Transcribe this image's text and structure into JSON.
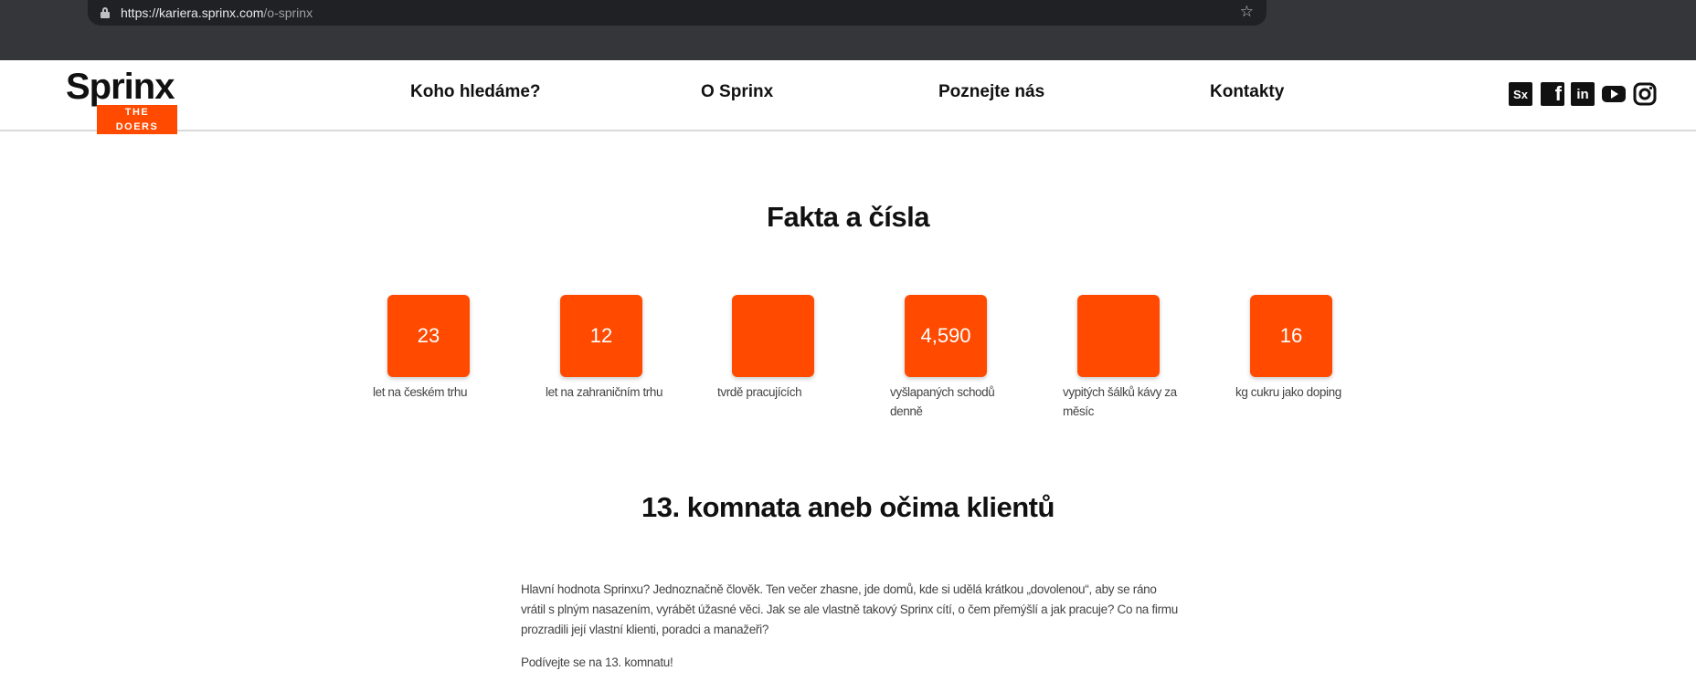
{
  "browser": {
    "url_host": "https://kariera.sprinx.com",
    "url_path": "/o-sprinx"
  },
  "header": {
    "logo_word": "Sprinx",
    "logo_tagline": "THE DOERS",
    "nav": [
      "Koho hledáme?",
      "O Sprinx",
      "Poznejte nás",
      "Kontakty"
    ],
    "social_icons": [
      "sx-icon",
      "facebook-icon",
      "linkedin-icon",
      "youtube-icon",
      "instagram-icon"
    ],
    "social_sx_label": "Sx",
    "social_fb_label": "f",
    "social_in_label": "in"
  },
  "facts": {
    "title": "Fakta a čísla",
    "items": [
      {
        "value": "23",
        "label": "let na českém trhu"
      },
      {
        "value": "12",
        "label": "let na zahraničním trhu"
      },
      {
        "value": "",
        "label": "tvrdě pracujících"
      },
      {
        "value": "4,590",
        "label": "vyšlapaných schodů denně"
      },
      {
        "value": "",
        "label": "vypitých šálků kávy za měsíc"
      },
      {
        "value": "16",
        "label": "kg cukru jako doping"
      }
    ]
  },
  "clients": {
    "title": "13. komnata aneb očima klientů",
    "paragraph_1": "Hlavní hodnota Sprinxu? Jednoznačně člověk. Ten večer zhasne, jde domů, kde si udělá krátkou „dovolenou“, aby se ráno vrátil s plným nasazením, vyrábět úžasné věci. Jak se ale vlastně takový Sprinx cítí, o čem přemýšlí a jak pracuje? Co na firmu prozradili její vlastní klienti, poradci a manažeři?",
    "paragraph_2": "Podívejte se na 13. komnatu!"
  },
  "colors": {
    "accent": "#ff4a00",
    "chrome_bg": "#35363a",
    "text": "#111111"
  }
}
